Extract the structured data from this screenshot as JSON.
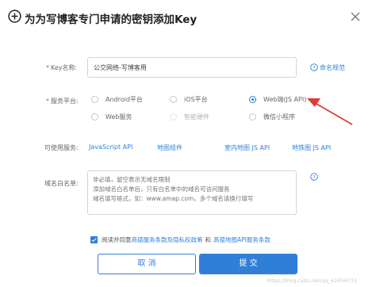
{
  "dialog": {
    "title": "为为写博客专门申请的密钥添加Key"
  },
  "form": {
    "key_name": {
      "label": "Key名称:",
      "value": "公交网络-写博客用",
      "help_link": "命名规范"
    },
    "platform": {
      "label": "服务平台:",
      "options": [
        {
          "label": "Android平台",
          "checked": false,
          "disabled": false
        },
        {
          "label": "iOS平台",
          "checked": false,
          "disabled": false
        },
        {
          "label": "Web端(JS API)",
          "checked": true,
          "disabled": false
        },
        {
          "label": "Web服务",
          "checked": false,
          "disabled": false
        },
        {
          "label": "智能硬件",
          "checked": false,
          "disabled": true
        },
        {
          "label": "微信小程序",
          "checked": false,
          "disabled": false
        }
      ]
    },
    "services": {
      "label": "可使用服务:",
      "items": [
        "JavaScript API",
        "地图组件",
        "室内地图 JS API",
        "地铁图 JS API"
      ]
    },
    "whitelist": {
      "label": "域名白名单:",
      "placeholder": "非必填，留空表示无域名限制\n添加域名白名单后，只有白名单中的域名可访问服务\n域名填写格式，如：www.amap.com，多个域名请换行填写"
    }
  },
  "agreement": {
    "prefix": "阅读并同意",
    "link1": "高德服务条款及隐私权政策",
    "middle": "和",
    "link2": "高德地图API服务条款"
  },
  "buttons": {
    "cancel": "取 消",
    "submit": "提 交"
  },
  "watermark": "https://blog.csdn.net/qq_41656733",
  "colors": {
    "accent": "#2f7fd8",
    "required_star": "#e84a4a",
    "annotation_arrow": "#e03a3a"
  },
  "icons": [
    "plus-circle-icon",
    "close-icon",
    "help-circle-icon",
    "annotation-arrow"
  ]
}
